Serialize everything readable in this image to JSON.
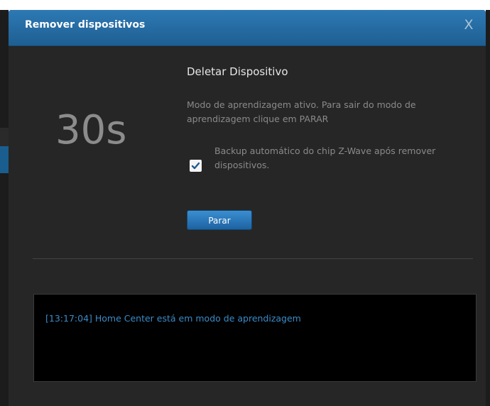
{
  "dialog": {
    "title": "Remover dispositivos",
    "close_label": "X"
  },
  "countdown": "30s",
  "heading": "Deletar Dispositivo",
  "info_text": "Modo de aprendizagem ativo. Para sair do modo de aprendizagem clique em PARAR",
  "backup_checkbox": {
    "checked": true,
    "label": "Backup automático do chip Z-Wave após remover dispositivos."
  },
  "stop_button_label": "Parar",
  "log": {
    "lines": [
      "[13:17:04] Home Center está em modo de aprendizagem"
    ]
  },
  "colors": {
    "title_bar": "#2366a0",
    "dialog_bg": "#262626",
    "accent_button": "#2b7bc0",
    "log_text": "#3b8bc8"
  }
}
